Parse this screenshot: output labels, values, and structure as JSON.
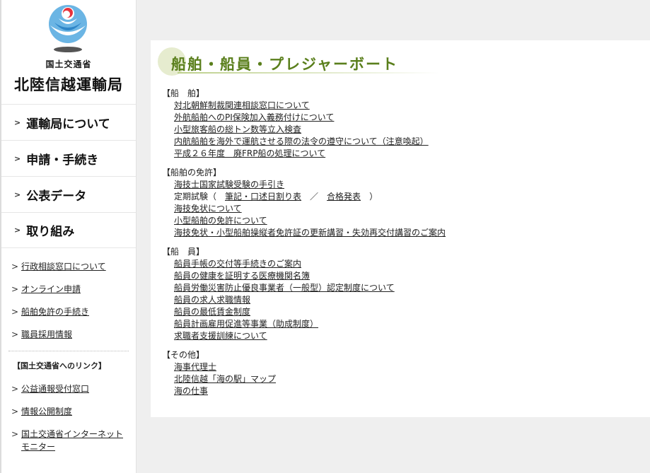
{
  "colors": {
    "title_green": "#5a7f1c",
    "logo_blue": "#4a9fd8",
    "logo_red": "#e8323c"
  },
  "sidebar": {
    "logo_icon": "mlit-emblem-icon",
    "ministry_name": "国土交通省",
    "bureau_name": "北陸信越運輸局",
    "main_nav": [
      {
        "label": "運輸局について"
      },
      {
        "label": "申請・手続き"
      },
      {
        "label": "公表データ"
      },
      {
        "label": "取り組み"
      }
    ],
    "sub_links": [
      {
        "label": "行政相談窓口について"
      },
      {
        "label": "オンライン申請"
      },
      {
        "label": "船舶免許の手続き"
      },
      {
        "label": "職員採用情報"
      }
    ],
    "mlit_links_heading": "【国土交通省へのリンク】",
    "mlit_links": [
      {
        "label": "公益通報受付窓口"
      },
      {
        "label": "情報公開制度"
      },
      {
        "label": "国土交通省インターネットモニター"
      }
    ]
  },
  "content": {
    "title": "船舶・船員・プレジャーボート",
    "sections": [
      {
        "heading": "【船　舶】",
        "items": [
          {
            "label": "対北朝鮮制裁関連相談窓口について"
          },
          {
            "label": "外航船舶へのPI保険加入義務付けについて"
          },
          {
            "label": "小型旅客船の総トン数等立入検査"
          },
          {
            "label": "内航船舶を海外で運航させる際の法令の遵守について（注意喚起）"
          },
          {
            "label": "平成２６年度　廃FRP船の処理について"
          }
        ]
      },
      {
        "heading": "【船舶の免許】",
        "items": [
          {
            "label": "海技士国家試験受験の手引き"
          },
          {
            "label": "海技免状について"
          },
          {
            "label": "小型船舶の免許について"
          },
          {
            "label": "海技免状・小型船舶操縦者免許証の更新講習・失効再交付講習のご案内"
          }
        ],
        "exam_line": {
          "prefix": "定期試験（　",
          "link1": "筆記・口述日割り表",
          "separator": "　／　",
          "link2": "合格発表",
          "suffix": "　）"
        }
      },
      {
        "heading": "【船　員】",
        "items": [
          {
            "label": "船員手帳の交付等手続きのご案内"
          },
          {
            "label": "船員の健康を証明する医療機関名簿"
          },
          {
            "label": "船員労働災害防止優良事業者（一般型）認定制度について"
          },
          {
            "label": "船員の求人求職情報"
          },
          {
            "label": "船員の最低賃金制度"
          },
          {
            "label": "船員計画雇用促進等事業（助成制度）"
          },
          {
            "label": "求職者支援訓練について"
          }
        ]
      },
      {
        "heading": "【その他】",
        "items": [
          {
            "label": "海事代理士"
          },
          {
            "label": "北陸信越「海の駅」マップ"
          },
          {
            "label": "海の仕事"
          }
        ]
      }
    ]
  }
}
